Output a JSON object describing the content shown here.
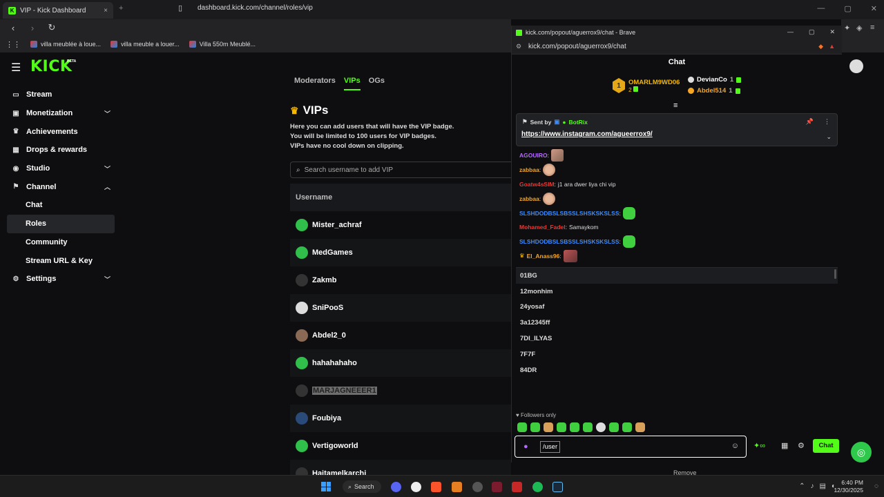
{
  "browser": {
    "tab_title": "VIP - Kick Dashboard",
    "url": "dashboard.kick.com/channel/roles/vip",
    "bookmarks": [
      "villa meublée à loue...",
      "villa meuble a louer...",
      "Villa 550m Meublé..."
    ]
  },
  "kick": {
    "logo": "KICK",
    "beta": "BETA",
    "sidebar": [
      {
        "label": "Stream",
        "icon": "stream-icon",
        "chevron": false
      },
      {
        "label": "Monetization",
        "icon": "dollar-icon",
        "chevron": "down"
      },
      {
        "label": "Achievements",
        "icon": "trophy-icon",
        "chevron": false
      },
      {
        "label": "Drops & rewards",
        "icon": "gift-icon",
        "chevron": false
      },
      {
        "label": "Studio",
        "icon": "studio-icon",
        "chevron": "down"
      },
      {
        "label": "Channel",
        "icon": "channel-icon",
        "chevron": "up"
      },
      {
        "label": "Chat",
        "sub": true
      },
      {
        "label": "Roles",
        "sub": true,
        "active": true
      },
      {
        "label": "Community",
        "sub": true
      },
      {
        "label": "Stream URL & Key",
        "sub": true
      },
      {
        "label": "Settings",
        "icon": "gear-icon",
        "chevron": "down"
      }
    ],
    "roles_tabs": [
      "Moderators",
      "VIPs",
      "OGs"
    ],
    "vip_title": "VIPs",
    "vip_desc": [
      "Here you can add users that will have the VIP badge.",
      "You will be limited to 100 users for VIP badges.",
      "VIPs have no cool down on clipping."
    ],
    "search_placeholder": "Search username to add VIP",
    "table_header": "Username",
    "vips": [
      "Mister_achraf",
      "MedGames",
      "Zakmb",
      "SniPooS",
      "Abdel2_0",
      "hahahahaho",
      "MARJAGNEEER1",
      "Foubiya",
      "Vertigoworld",
      "Haitamelkarchi"
    ],
    "remove_label": "Remove"
  },
  "chat_window": {
    "title": "kick.com/popout/aguerrox9/chat - Brave",
    "url": "kick.com/popout/aguerrox9/chat",
    "header": "Chat",
    "leaderboard": {
      "first": {
        "rank": "1",
        "name": "OMARLM9WD06",
        "count": "2"
      },
      "others": [
        {
          "name": "DevianCo",
          "count": "1",
          "color": "#ffffff"
        },
        {
          "name": "Abdel514",
          "count": "1",
          "color": "#f5a623"
        }
      ]
    },
    "pinned": {
      "sent_by": "Sent by",
      "bot": "BotRix",
      "link": "https://www.instagram.com/agueerrox9/"
    },
    "messages": [
      {
        "user": "AGOUIRO",
        "color": "#b56bff",
        "text": "",
        "emote": "pink"
      },
      {
        "user": "zabbaa",
        "color": "#f5a623",
        "text": "",
        "emote": "face"
      },
      {
        "user": "Goatw4sSIM",
        "color": "#e53935",
        "text": "j1 ara dwer liya chi vip",
        "emote": ""
      },
      {
        "user": "zabbaa",
        "color": "#f5a623",
        "text": "",
        "emote": "face"
      },
      {
        "user": "SLSHDODBSLSBSSLSHSKSKSLSS",
        "color": "#3a8bff",
        "text": "",
        "emote": "green"
      },
      {
        "user": "Mohamed_Fadel",
        "color": "#e53935",
        "text": "Samaykom",
        "emote": ""
      },
      {
        "user": "SLSHDODBSLSBSSLSHSKSKSLSS",
        "color": "#3a8bff",
        "text": "",
        "emote": "green"
      },
      {
        "user": "El_Anass96",
        "color": "#f5a623",
        "text": "",
        "emote": "car",
        "crown": true
      }
    ],
    "suggestions": [
      "01BG",
      "12monhim",
      "24yosaf",
      "3a12345ff",
      "7DI_ILYAS",
      "7F7F",
      "84DR"
    ],
    "followers_only": "Followers only",
    "input_value": "/user",
    "send_label": "Chat"
  },
  "taskbar": {
    "search": "Search",
    "time": "6:40 PM",
    "date": "12/30/2025"
  }
}
